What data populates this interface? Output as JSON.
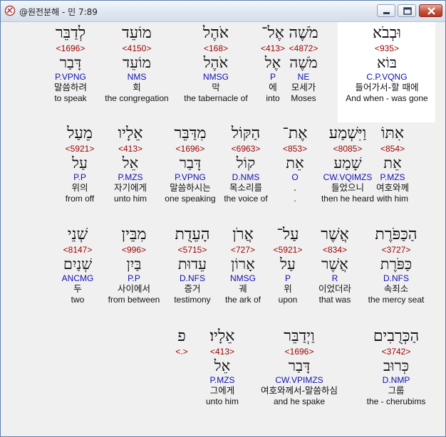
{
  "window": {
    "title": "@원전분해 - 민 7:89"
  },
  "rows": [
    [
      {
        "heb": "וּבְבֹא",
        "strong": "<935>",
        "lemma": "בּוֹא",
        "gram": "C.P.VQNG",
        "kor": "들어가서-할 때에",
        "eng": "And when - was gone",
        "highlight": true
      },
      {
        "heb": "מֹשֶׁה",
        "strong": "<4872>",
        "lemma": "מֹשֶׁה",
        "gram": "NE",
        "kor": "모세가",
        "eng": "Moses"
      },
      {
        "heb": "אֶל־",
        "strong": "<413>",
        "lemma": "אֶל",
        "gram": "P",
        "kor": "에",
        "eng": "into"
      },
      {
        "heb": "אֹהֶל",
        "strong": "<168>",
        "lemma": "אֹהֶל",
        "gram": "NMSG",
        "kor": "막",
        "eng": "the tabernacle of"
      },
      {
        "heb": "מוֹעֵד",
        "strong": "<4150>",
        "lemma": "מוֹעֵד",
        "gram": "NMS",
        "kor": "회",
        "eng": "the congregation"
      },
      {
        "heb": "לְדַבֵּר",
        "strong": "<1696>",
        "lemma": "דָּבַר",
        "gram": "P.VPNG",
        "kor": "말씀하려",
        "eng": "to speak"
      }
    ],
    [
      {
        "heb": "אִתּוֹ",
        "strong": "<854>",
        "lemma": "אֵת",
        "gram": "P.MZS",
        "kor": "여호와께",
        "eng": "with him"
      },
      {
        "heb": "וַיִּשְׁמַע",
        "strong": "<8085>",
        "lemma": "שָׁמַע",
        "gram": "CW.VQIMZS",
        "kor": "들었으니",
        "eng": "then he heard"
      },
      {
        "heb": "אֶת־",
        "strong": "<853>",
        "lemma": "אֵת",
        "gram": "O",
        "kor": ".",
        "eng": "."
      },
      {
        "heb": "הַקּוֹל",
        "strong": "<6963>",
        "lemma": "קוֹל",
        "gram": "D.NMS",
        "kor": "목소리를",
        "eng": "the voice of"
      },
      {
        "heb": "מִדַּבֵּר",
        "strong": "<1696>",
        "lemma": "דָּבַר",
        "gram": "P.VPNG",
        "kor": "말씀하시는",
        "eng": "one speaking"
      },
      {
        "heb": "אֵלָיו",
        "strong": "<413>",
        "lemma": "אֵל",
        "gram": "P.MZS",
        "kor": "자기에게",
        "eng": "unto him"
      },
      {
        "heb": "מֵעַל",
        "strong": "<5921>",
        "lemma": "עַל",
        "gram": "P.P",
        "kor": "위의",
        "eng": "from off"
      }
    ],
    [
      {
        "heb": "הַכַּפֹּרֶת",
        "strong": "<3727>",
        "lemma": "כַּפֹּרֶת",
        "gram": "D.NFS",
        "kor": "속죄소",
        "eng": "the mercy seat"
      },
      {
        "heb": "אֲשֶׁר",
        "strong": "<834>",
        "lemma": "אֲשֶׁר",
        "gram": "R",
        "kor": "이었더라",
        "eng": "that was"
      },
      {
        "heb": "עַל־",
        "strong": "<5921>",
        "lemma": "עַל",
        "gram": "P",
        "kor": "위",
        "eng": "upon"
      },
      {
        "heb": "אֲרֹן",
        "strong": "<727>",
        "lemma": "אָרוֹן",
        "gram": "NMSG",
        "kor": "궤",
        "eng": "the ark of"
      },
      {
        "heb": "הָעֵדֻת",
        "strong": "<5715>",
        "lemma": "עֵדוּת",
        "gram": "D.NFS",
        "kor": "증거",
        "eng": "testimony"
      },
      {
        "heb": "מִבֵּין",
        "strong": "<996>",
        "lemma": "בַּיִן",
        "gram": "P.P",
        "kor": "사이에서",
        "eng": "from between"
      },
      {
        "heb": "שְׁנֵי",
        "strong": "<8147>",
        "lemma": "שְׁנַיִם",
        "gram": "ANCMG",
        "kor": "두",
        "eng": "two"
      }
    ],
    [
      {
        "heb": "הַכְּרֻבִים",
        "strong": "<3742>",
        "lemma": "כְּרוּב",
        "gram": "D.NMP",
        "kor": "그룹",
        "eng": "the - cherubims"
      },
      {
        "heb": "וַיְדַבֵּר",
        "strong": "<1696>",
        "lemma": "דָּבַר",
        "gram": "CW.VPIMZS",
        "kor": "여호와께서-말씀하심",
        "eng": "and he spake"
      },
      {
        "heb": "אֵלָיו׃",
        "strong": "<413>",
        "lemma": "אֵל",
        "gram": "P.MZS",
        "kor": "그에게",
        "eng": "unto him"
      },
      {
        "heb": "פ",
        "strong": "<.>",
        "lemma": "",
        "gram": "",
        "kor": "",
        "eng": ""
      }
    ]
  ]
}
